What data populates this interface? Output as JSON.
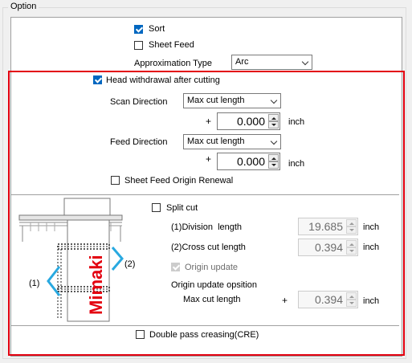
{
  "group_title": "Option",
  "sort": {
    "label": "Sort",
    "checked": true
  },
  "sheet_feed": {
    "label": "Sheet Feed",
    "checked": false
  },
  "approximation": {
    "label": "Approximation Type",
    "value": "Arc"
  },
  "head_withdrawal": {
    "label": "Head withdrawal after cutting",
    "checked": true
  },
  "scan_direction": {
    "label": "Scan Direction",
    "mode": "Max cut length",
    "sign": "+",
    "value": "0.000",
    "unit": "inch"
  },
  "feed_direction": {
    "label": "Feed Direction",
    "mode": "Max cut length",
    "sign": "+",
    "value": "0.000",
    "unit": "inch"
  },
  "sheet_feed_origin_renewal": {
    "label": "Sheet Feed Origin Renewal",
    "checked": false
  },
  "split_cut": {
    "label": "Split cut",
    "checked": false,
    "division_label": "(1)Division  length",
    "division_value": "19.685",
    "division_unit": "inch",
    "crosscut_label": "(2)Cross cut length",
    "crosscut_value": "0.394",
    "crosscut_unit": "inch",
    "origin_update_label": "Origin update",
    "origin_update_checked": true,
    "origin_update_position_label": "Origin update opsition",
    "max_cut_label": "Max cut length",
    "max_cut_sign": "+",
    "max_cut_value": "0.394",
    "max_cut_unit": "inch"
  },
  "diagram": {
    "brand": "Mimaki",
    "label_1": "(1)",
    "label_2": "(2)"
  },
  "double_pass": {
    "label": "Double pass creasing(CRE)",
    "checked": false
  },
  "colors": {
    "accent": "#0067c0",
    "highlight_frame": "#e3000f",
    "brand_red": "#e3000f",
    "marker": "#29a9e0"
  }
}
